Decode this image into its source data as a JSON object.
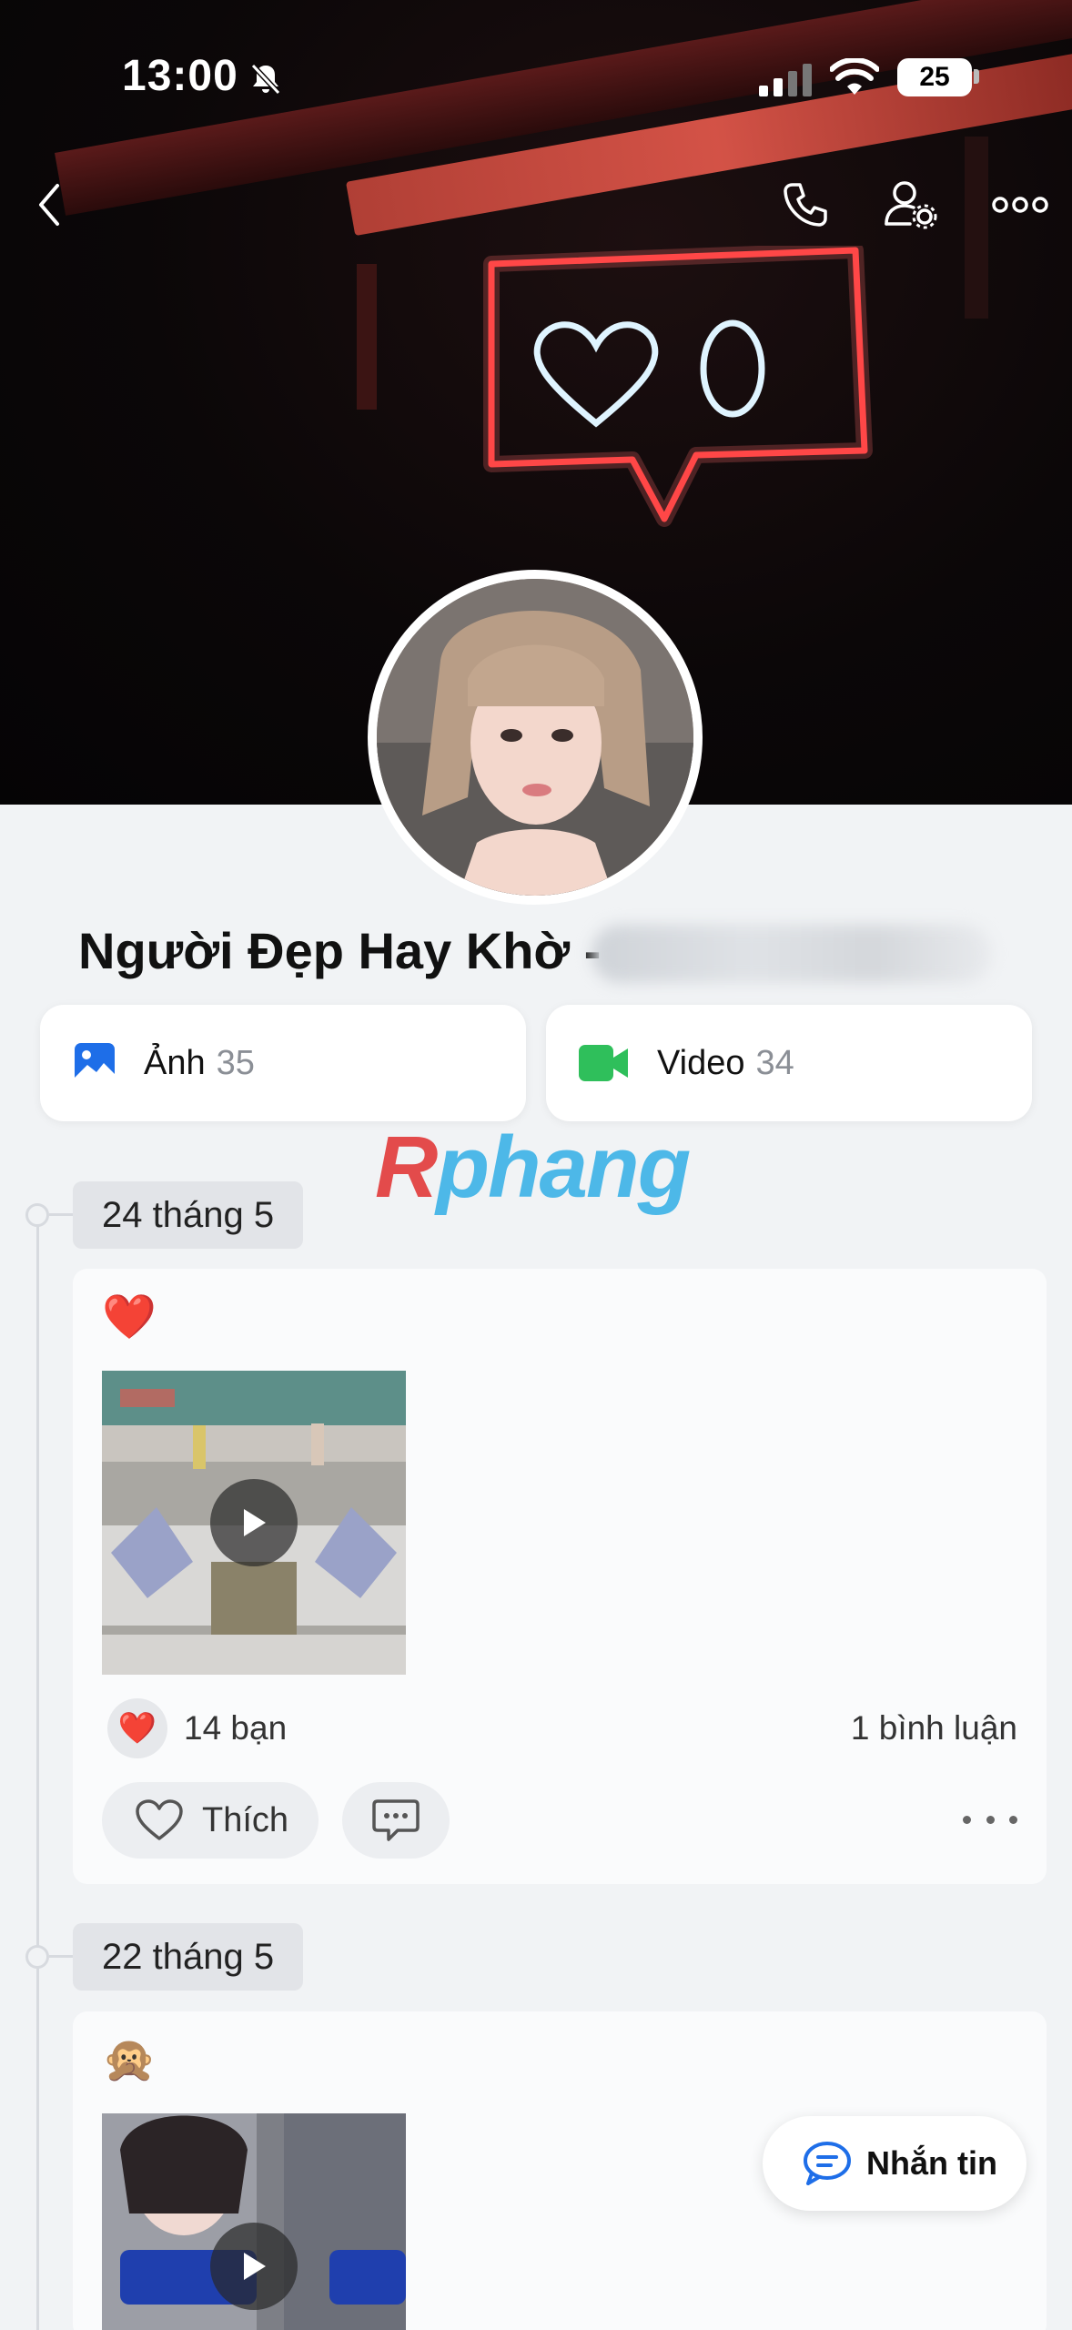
{
  "status_bar": {
    "time": "13:00",
    "battery": "25",
    "icons": [
      "silent-bell-icon",
      "signal-icon",
      "wifi-icon",
      "battery-icon"
    ]
  },
  "top_nav": {
    "icons": [
      "back-chevron-icon",
      "phone-icon",
      "user-settings-icon",
      "more-dots-icon"
    ]
  },
  "profile": {
    "name": "Người Đẹp Hay Khờ -"
  },
  "media": {
    "photos": {
      "label": "Ảnh",
      "count": "35",
      "icon": "image-icon"
    },
    "videos": {
      "label": "Video",
      "count": "34",
      "icon": "video-camera-icon"
    }
  },
  "watermark": {
    "part1": "R",
    "part2": "phang"
  },
  "timeline": [
    {
      "date": "24 tháng 5",
      "emoji": "❤️",
      "reaction_emoji": "❤️",
      "reactions": "14 bạn",
      "comments": "1 bình luận",
      "like_label": "Thích"
    },
    {
      "date": "22 tháng 5",
      "emoji": "🙊"
    }
  ],
  "fab": {
    "label": "Nhắn tin",
    "icon": "chat-bubble-icon"
  },
  "colors": {
    "accent_blue": "#1e6ee8",
    "video_green": "#2fbf5b",
    "heart_red": "#e0243a"
  }
}
